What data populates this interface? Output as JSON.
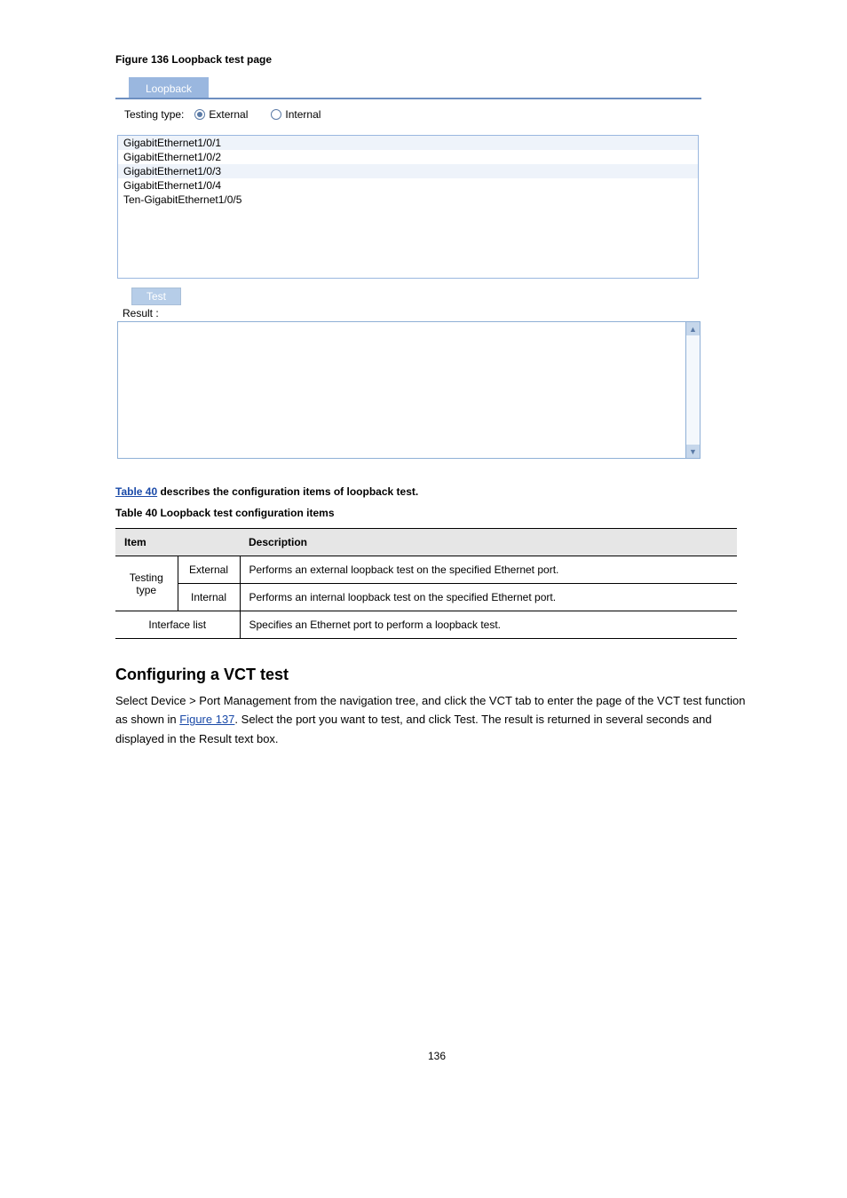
{
  "figure_label": "Figure 136 Loopback test page",
  "loopback": {
    "tab_label": "Loopback",
    "testing_type_label": "Testing type:",
    "radio_external": "External",
    "radio_internal": "Internal",
    "ports": [
      "GigabitEthernet1/0/1",
      "GigabitEthernet1/0/2",
      "GigabitEthernet1/0/3",
      "GigabitEthernet1/0/4",
      "Ten-GigabitEthernet1/0/5"
    ],
    "test_button": "Test",
    "result_label": "Result :"
  },
  "table_caption_prefix": "Table 40",
  "table_caption_rest": " describes the configuration items of loopback test.",
  "table_title": "Table 40 Loopback test configuration items",
  "table": {
    "header_item": "Item",
    "header_desc": "Description",
    "row1_label": "Testing type",
    "row1a_sub": "External",
    "row1a_desc": "Performs an external loopback test on the specified Ethernet port.",
    "row1b_sub": "Internal",
    "row1b_desc": "Performs an internal loopback test on the specified Ethernet port.",
    "row2_label": "Interface list",
    "row2_desc": "Specifies an Ethernet port to perform a loopback test."
  },
  "h2": "Configuring a VCT test",
  "para": "Select Device > Port Management from the navigation tree, and click the VCT tab to enter the page of the VCT test function as shown in ",
  "figref": "Figure 137",
  "para_tail": ". Select the port you want to test, and click Test. The result is returned in several seconds and displayed in the Result text box.",
  "page_number": "136"
}
